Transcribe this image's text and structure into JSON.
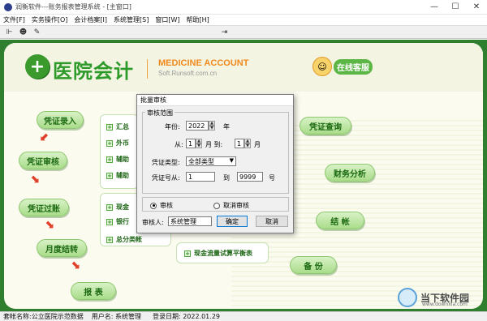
{
  "window": {
    "title": "润衡软件---账务报表管理系统 - [主窗口]"
  },
  "menu": [
    {
      "label": "文件[F]"
    },
    {
      "label": "实务操作[O]"
    },
    {
      "label": "会计档案[I]"
    },
    {
      "label": "系统管理[S]"
    },
    {
      "label": "窗口[W]"
    },
    {
      "label": "帮助[H]"
    }
  ],
  "brand": {
    "name_cn": "医院会计",
    "name_en": "MEDICINE ACCOUNT",
    "url": "Soft.Runsoft.com.cn",
    "online_service": "在线客服"
  },
  "flow_buttons": {
    "voucher_entry": "凭证录入",
    "voucher_review": "凭证审核",
    "voucher_post": "凭证过账",
    "month_close": "月度结转",
    "report": "报 表",
    "voucher_query": "凭证查询",
    "financial_analysis": "财务分析",
    "closing": "结 帐",
    "backup": "备 份"
  },
  "submenu_items": {
    "summary": "汇总",
    "foreign": "外币",
    "aux1": "辅助",
    "aux2": "辅助",
    "cash": "现金",
    "bank": "银行",
    "general_ledger": "总分类帐",
    "cashflow": "现金流量试算平衡表"
  },
  "dialog": {
    "title": "批量审核",
    "group_label": "审核范围",
    "year_label": "年份:",
    "year_value": "2022",
    "year_unit": "年",
    "from_label": "从:",
    "month_from": "1",
    "month_label_1": "月 到:",
    "month_to": "1",
    "month_label_2": "月",
    "type_label": "凭证类型:",
    "type_value": "全部类型",
    "num_label": "凭证号从:",
    "num_from": "1",
    "num_to_label": "到",
    "num_to": "9999",
    "num_unit": "号",
    "radio_review": "审核",
    "radio_cancel": "取消审核",
    "reviewer_label": "审核人:",
    "reviewer_value": "系统管理",
    "ok": "确定",
    "cancel": "取消"
  },
  "status": {
    "account_set": "套帐名称:公立医院示范数据",
    "user": "用户名: 系统管理",
    "login_date": "登录日期: 2022.01.29"
  },
  "watermark": {
    "text": "当下软件园",
    "url": "www.downxia.com"
  }
}
